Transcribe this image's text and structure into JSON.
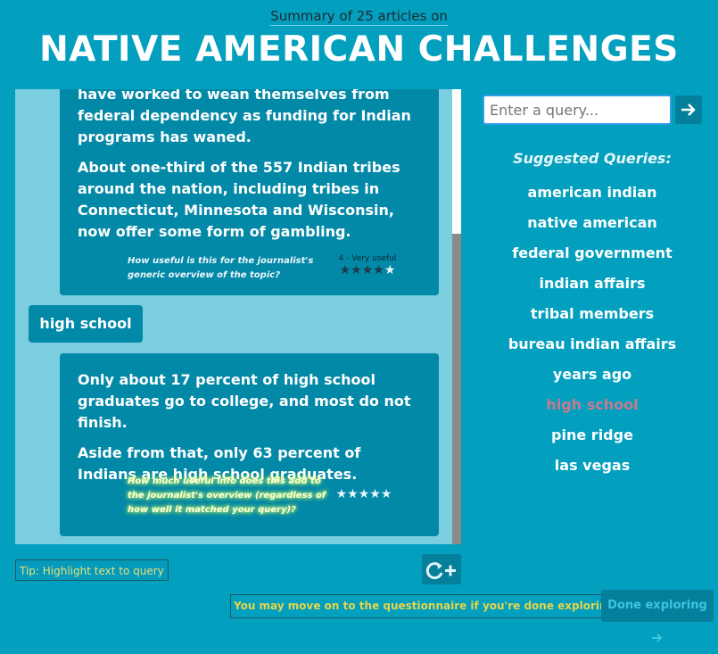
{
  "header": {
    "subtitle": "Summary of 25 articles on",
    "title": "NATIVE AMERICAN CHALLENGES"
  },
  "chat": {
    "card1": {
      "para1": "have worked to wean themselves from federal dependency as funding for Indian programs has waned.",
      "para2": "About one-third of the 557 Indian tribes around the nation, including tribes in Connecticut, Minnesota and Wisconsin, now offer some form of gambling.",
      "rating_question": "How useful is this for the journalist's generic overview of the topic?",
      "rating_label": "4 - Very useful",
      "rating_value": 4,
      "rating_max": 5
    },
    "query_bubble": "high school",
    "card2": {
      "para1": "Only about 17 percent of high school graduates go to college, and most do not finish.",
      "para2": "Aside from that, only 63 percent of Indians are high school graduates.",
      "rating_question": "How much useful info does this add to the journalist's overview (regardless of how well it matched your query)?",
      "rating_value": 0,
      "rating_max": 5
    }
  },
  "tip": "Tip: Highlight text to query",
  "refresh_icon": "refresh-plus-icon",
  "search": {
    "placeholder": "Enter a query...",
    "go_icon": "arrow-right-icon"
  },
  "suggestions": {
    "title": "Suggested Queries:",
    "items": [
      "american indian",
      "native american",
      "federal government",
      "indian affairs",
      "tribal members",
      "bureau indian affairs",
      "years ago",
      "high school",
      "pine ridge",
      "las vegas"
    ],
    "active_index": 7
  },
  "footer": {
    "move_on": "You may move on to the questionnaire if you're done exploring.",
    "done_label": "Done exploring"
  },
  "colors": {
    "background": "#029fbe",
    "card": "#0389a8",
    "chat_bg": "#7bcde0",
    "active_suggestion": "#c97a8e",
    "notice_text": "#e6d44a"
  }
}
